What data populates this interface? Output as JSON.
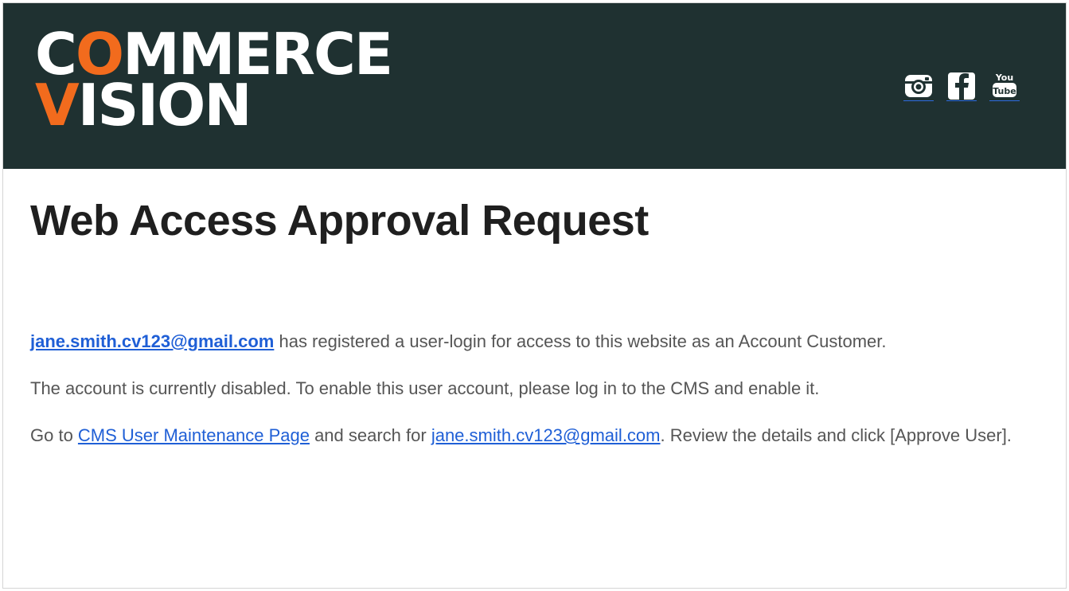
{
  "brand": {
    "logo_line1_pre": "C",
    "logo_line1_accent": "O",
    "logo_line1_post": "MMERCE",
    "logo_line2_accent": "V",
    "logo_line2_post": "ISION",
    "accent_color": "#f26b1d",
    "header_bg": "#1f3131"
  },
  "social": [
    {
      "icon": "instagram-icon"
    },
    {
      "icon": "facebook-icon"
    },
    {
      "icon": "youtube-icon",
      "text_top": "You",
      "text_bottom": "Tube"
    }
  ],
  "page_title": "Web Access Approval Request",
  "body": {
    "email": "jane.smith.cv123@gmail.com",
    "p1_text": " has registered a user-login for access to this website as an Account Customer.",
    "p2_text": "The account is currently disabled. To enable this user account, please log in to the CMS and enable it.",
    "p3_go_to": "Go to ",
    "p3_cms_link": "CMS User Maintenance Page",
    "p3_search_for": " and search for ",
    "p3_email_link": "jane.smith.cv123@gmail.com",
    "p3_tail": ". Review the details and click [Approve User]."
  },
  "colors": {
    "link": "#1f5fd6",
    "body_text": "#555555",
    "title_text": "#1f1f1f"
  }
}
